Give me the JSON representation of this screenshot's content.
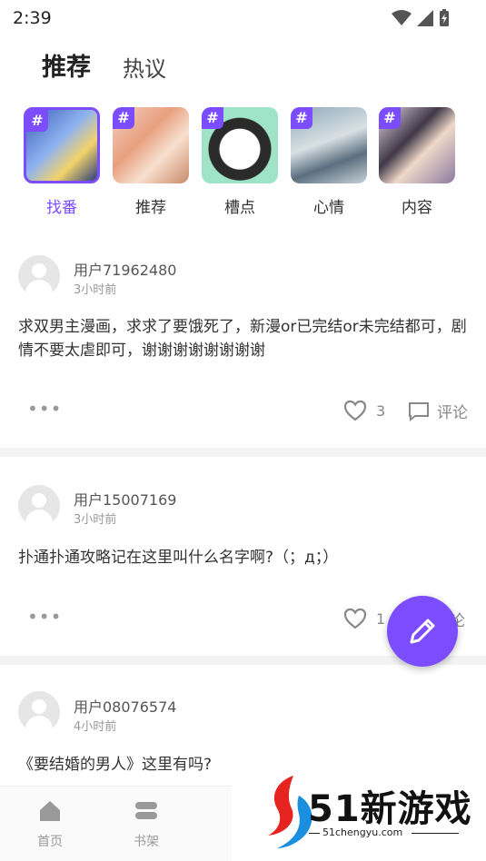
{
  "status": {
    "time": "2:39"
  },
  "tabs": [
    {
      "label": "推荐",
      "active": true
    },
    {
      "label": "热议",
      "active": false
    }
  ],
  "categories": [
    {
      "label": "找番",
      "hash": "#",
      "selected": true
    },
    {
      "label": "推荐",
      "hash": "#",
      "selected": false
    },
    {
      "label": "槽点",
      "hash": "#",
      "selected": false
    },
    {
      "label": "心情",
      "hash": "#",
      "selected": false
    },
    {
      "label": "内容",
      "hash": "#",
      "selected": false
    }
  ],
  "posts": [
    {
      "user": "用户71962480",
      "time": "3小时前",
      "content": "求双男主漫画，求求了要饿死了，新漫or已完结or未完结都可，剧情不要太虐即可，谢谢谢谢谢谢谢谢",
      "more": "•••",
      "likes": "3",
      "comment_label": "评论"
    },
    {
      "user": "用户15007169",
      "time": "3小时前",
      "content": "扑通扑通攻略记在这里叫什么名字啊?（；д；）",
      "more": "•••",
      "likes": "1",
      "comment_label": "论"
    },
    {
      "user": "用户08076574",
      "time": "4小时前",
      "content": "《要结婚的男人》这里有吗?",
      "more": "",
      "likes": "",
      "comment_label": ""
    }
  ],
  "bottom_nav": [
    {
      "label": "首页",
      "icon": "home-icon"
    },
    {
      "label": "书架",
      "icon": "bookshelf-icon"
    }
  ],
  "watermark": {
    "text": "51新游戏",
    "url": "51chengyu.com"
  },
  "colors": {
    "accent": "#7b4dff",
    "tab_underline": "#28c8b0"
  }
}
